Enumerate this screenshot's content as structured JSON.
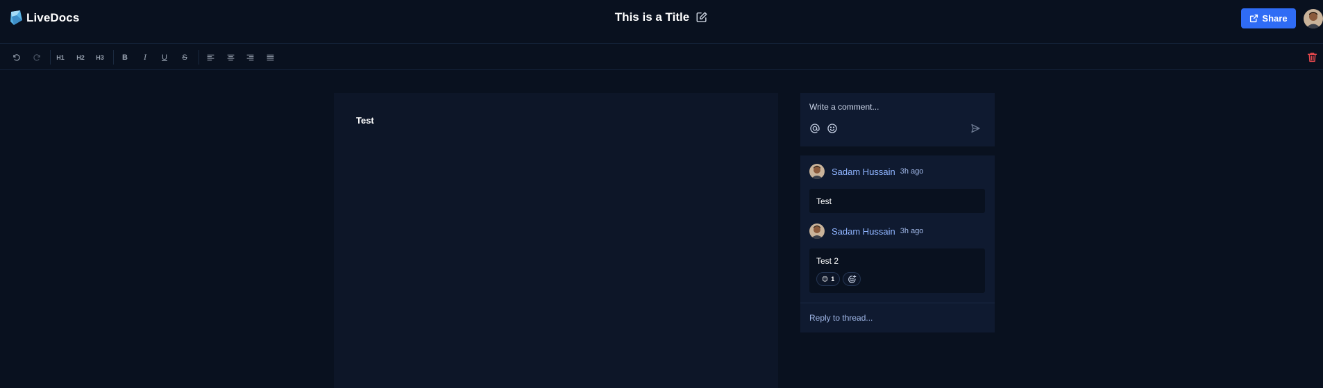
{
  "app": {
    "name": "LiveDocs"
  },
  "document": {
    "title": "This is a Title",
    "body_text": "Test"
  },
  "header": {
    "share_label": "Share"
  },
  "toolbar": {
    "undo": "undo-icon",
    "redo": "redo-icon",
    "h1": "H1",
    "h2": "H2",
    "h3": "H3",
    "bold": "B",
    "italic": "I",
    "underline": "U",
    "strike": "S"
  },
  "composer": {
    "placeholder": "Write a comment..."
  },
  "thread": {
    "comments": [
      {
        "author": "Sadam Hussain",
        "time": "3h ago",
        "text": "Test"
      },
      {
        "author": "Sadam Hussain",
        "time": "3h ago",
        "text": "Test 2",
        "reaction": {
          "emoji": "😊",
          "count": "1"
        }
      }
    ],
    "reply_placeholder": "Reply to thread..."
  },
  "colors": {
    "accent": "#2f6cf5",
    "background": "#09111f",
    "panel": "#0f1a30",
    "danger": "#e5484d"
  }
}
